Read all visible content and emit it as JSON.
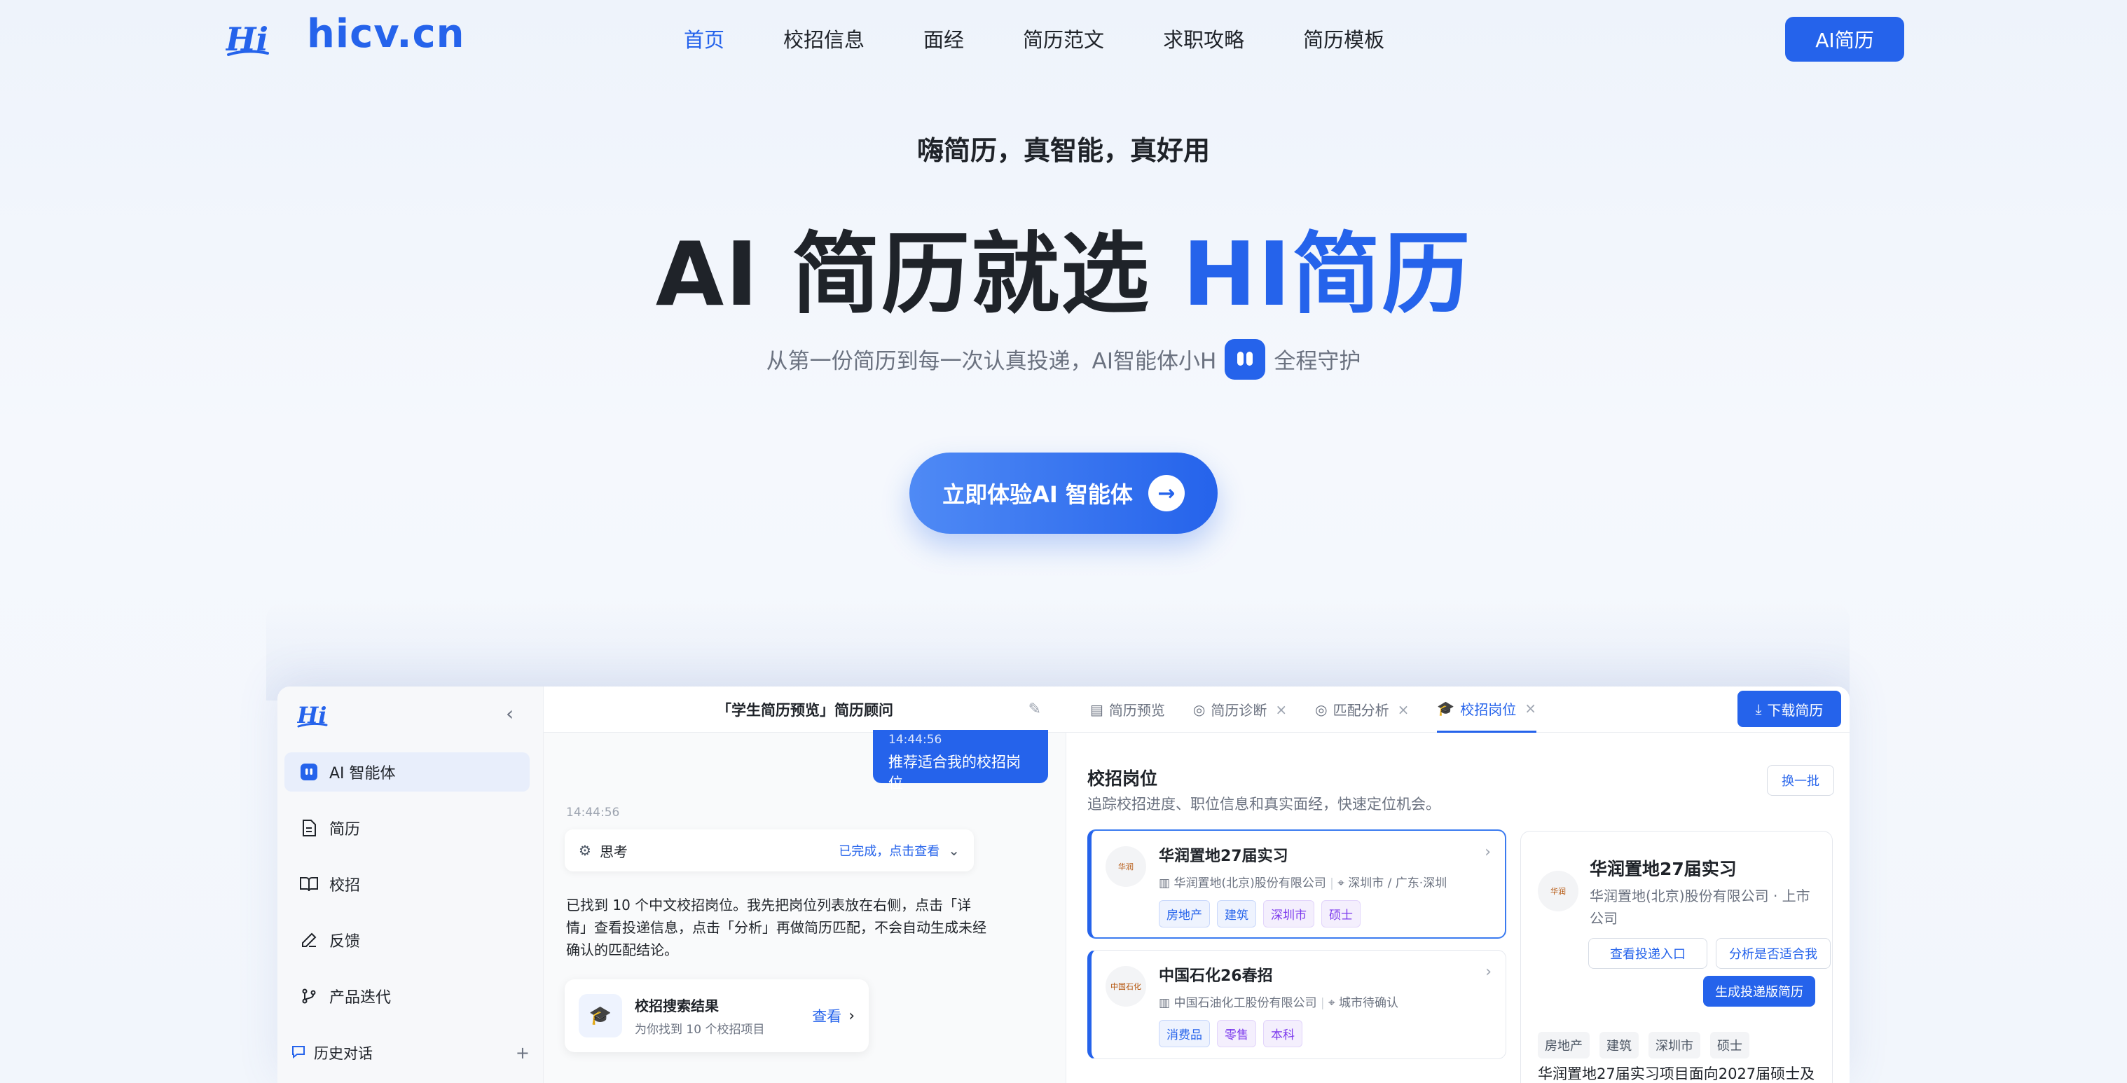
{
  "nav": {
    "brand": "hicv.cn",
    "links": [
      "首页",
      "校招信息",
      "面经",
      "简历范文",
      "求职攻略",
      "简历模板"
    ],
    "cta_label": "AI简历",
    "accent_color": "#2563eb"
  },
  "hero": {
    "tagline": "嗨简历，真智能，真好用",
    "title_main": "AI 简历就选 ",
    "title_accent": "HI简历",
    "subtitle_before": "从第一份简历到每一次认真投递，AI智能体小H",
    "subtitle_after": "全程守护",
    "cta_label": "立即体验AI 智能体"
  },
  "mockup": {
    "sidebar": {
      "items": [
        "AI 智能体",
        "简历",
        "校招",
        "反馈",
        "产品迭代"
      ],
      "history_label": "历史对话"
    },
    "chat": {
      "header": "「学生简历预览」简历顾问",
      "user_time": "14:44:56",
      "user_message": "推荐适合我的校招岗位",
      "bot_time": "14:44:56",
      "think_label": "思考",
      "think_status": "已完成，点击查看",
      "reply_text": "已找到 10 个中文校招岗位。我先把岗位列表放在右侧，点击「详情」查看投递信息，点击「分析」再做简历匹配，不会自动生成未经确认的匹配结论。",
      "result_title": "校招搜索结果",
      "result_sub": "为你找到 10 个校招项目",
      "result_view": "查看"
    },
    "panel": {
      "tabs": [
        "简历预览",
        "简历诊断",
        "匹配分析",
        "校招岗位"
      ],
      "download_label": "下载简历",
      "section_title": "校招岗位",
      "section_sub": "追踪校招进度、职位信息和真实面经，快速定位机会。",
      "swap_label": "换一批",
      "jobs": [
        {
          "title": "华润置地27届实习",
          "company": "华润置地(北京)股份有限公司",
          "location": "深圳市 / 广东·深圳",
          "tags": [
            "房地产",
            "建筑",
            "深圳市",
            "硕士"
          ]
        },
        {
          "title": "中国石化26春招",
          "company": "中国石油化工股份有限公司",
          "location": "城市待确认",
          "tags": [
            "消费品",
            "零售",
            "本科"
          ]
        }
      ],
      "detail": {
        "title": "华润置地27届实习",
        "company": "华润置地(北京)股份有限公司 · 上市公司",
        "btn_entry": "查看投递入口",
        "btn_analyze": "分析是否适合我",
        "btn_generate": "生成投递版简历",
        "tags": [
          "房地产",
          "建筑",
          "深圳市",
          "硕士"
        ],
        "desc": "华润置地27届实习项目面向2027届硕士及"
      }
    }
  }
}
